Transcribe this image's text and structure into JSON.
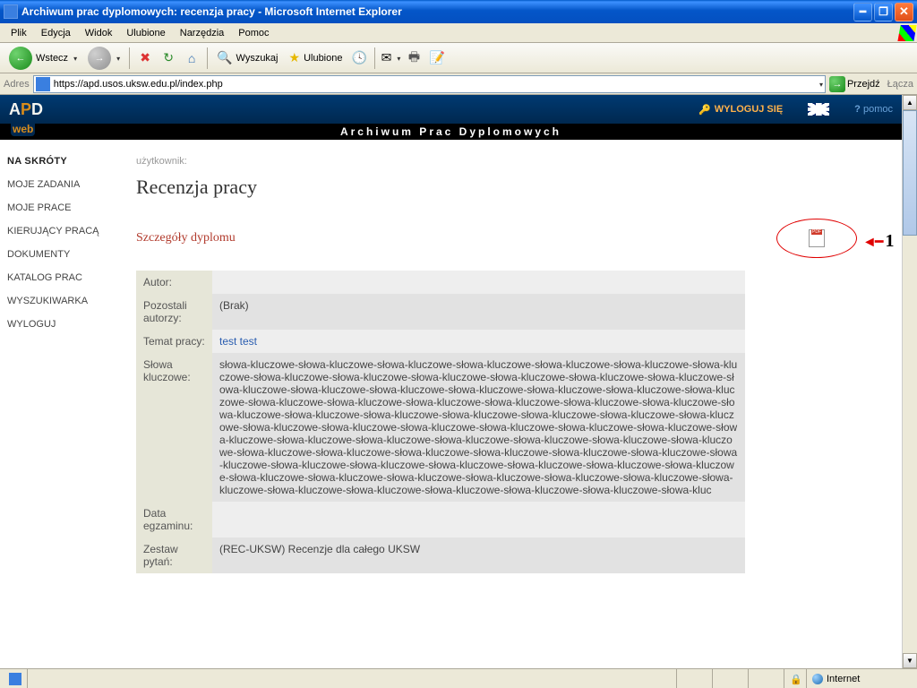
{
  "window": {
    "title": "Archiwum prac dyplomowych: recenzja pracy - Microsoft Internet Explorer"
  },
  "menu": {
    "plik": "Plik",
    "edycja": "Edycja",
    "widok": "Widok",
    "ulubione": "Ulubione",
    "narzedzia": "Narzędzia",
    "pomoc": "Pomoc"
  },
  "toolbar": {
    "back": "Wstecz",
    "search": "Wyszukaj",
    "fav": "Ulubione"
  },
  "address": {
    "label": "Adres",
    "url": "https://apd.usos.uksw.edu.pl/index.php",
    "go": "Przejdź",
    "links": "Łącza"
  },
  "apd": {
    "logout": "WYLOGUJ SIĘ",
    "pomoc": "pomoc",
    "band": "Archiwum  Prac  Dyplomowych",
    "web": "web"
  },
  "sidebar": {
    "head": "NA SKRÓTY",
    "items": [
      "MOJE ZADANIA",
      "MOJE PRACE",
      "KIERUJĄCY PRACĄ",
      "DOKUMENTY",
      "KATALOG PRAC",
      "WYSZUKIWARKA",
      "WYLOGUJ"
    ]
  },
  "main": {
    "userline": "użytkownik:",
    "h1": "Recenzja pracy",
    "h2": "Szczegóły dyplomu",
    "arrow_num": "1"
  },
  "details": {
    "rows": [
      {
        "label": "Autor:",
        "value": ""
      },
      {
        "label": "Pozostali autorzy:",
        "value": "(Brak)"
      },
      {
        "label": "Temat pracy:",
        "value": "test test",
        "link": true
      },
      {
        "label": "Słowa kluczowe:",
        "value": "słowa-kluczowe-słowa-kluczowe-słowa-kluczowe-słowa-kluczowe-słowa-kluczowe-słowa-kluczowe-słowa-kluczowe-słowa-kluczowe-słowa-kluczowe-słowa-kluczowe-słowa-kluczowe-słowa-kluczowe-słowa-kluczowe-słowa-kluczowe-słowa-kluczowe-słowa-kluczowe-słowa-kluczowe-słowa-kluczowe-słowa-kluczowe-słowa-kluczowe-słowa-kluczowe-słowa-kluczowe-słowa-kluczowe-słowa-kluczowe-słowa-kluczowe-słowa-kluczowe-słowa-kluczowe-słowa-kluczowe-słowa-kluczowe-słowa-kluczowe-słowa-kluczowe-słowa-kluczowe-słowa-kluczowe-słowa-kluczowe-słowa-kluczowe-słowa-kluczowe-słowa-kluczowe-słowa-kluczowe-słowa-kluczowe-słowa-kluczowe-słowa-kluczowe-słowa-kluczowe-słowa-kluczowe-słowa-kluczowe-słowa-kluczowe-słowa-kluczowe-słowa-kluczowe-słowa-kluczowe-słowa-kluczowe-słowa-kluczowe-słowa-kluczowe-słowa-kluczowe-słowa-kluczowe-słowa-kluczowe-słowa-kluczowe-słowa-kluczowe-słowa-kluczowe-słowa-kluczowe-słowa-kluczowe-słowa-kluczowe-słowa-kluczowe-słowa-kluczowe-słowa-kluczowe-słowa-kluczowe-słowa-kluczowe-słowa-kluczowe-słowa-kluczowe-słowa-kluczowe-słowa-kluczowe-słowa-kluczowe-słowa-kluczowe-słowa-kluc"
      },
      {
        "label": "Data egzaminu:",
        "value": ""
      },
      {
        "label": "Zestaw pytań:",
        "value": "(REC-UKSW) Recenzje dla całego UKSW"
      }
    ]
  },
  "status": {
    "zone": "Internet"
  }
}
